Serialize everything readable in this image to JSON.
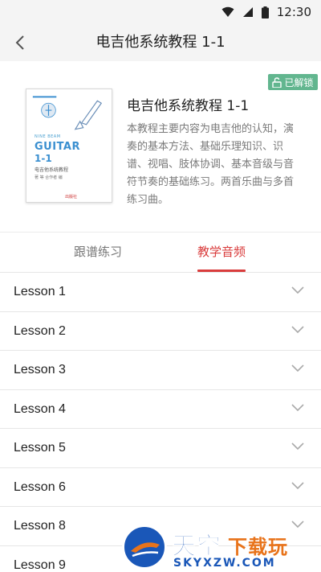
{
  "status_bar": {
    "time": "12:30",
    "icons": [
      "wifi-icon",
      "signal-icon",
      "battery-icon"
    ]
  },
  "nav": {
    "title": "电吉他系统教程 1-1",
    "back_icon": "chevron-left-icon"
  },
  "course": {
    "unlock_badge": "已解锁",
    "unlock_icon": "unlock-icon",
    "title": "电吉他系统教程 1-1",
    "description": "本教程主要内容为电吉他的认知，演奏的基本方法、基础乐理知识、识谱、视唱、肢体协调、基本音级与音符节奏的基础练习。两首乐曲与多首练习曲。",
    "cover": {
      "series": "NINE BEAM",
      "instrument": "GUITAR",
      "level": "1-1",
      "subtitle": "电吉他系统教程",
      "authors": "著  等  合作者  编",
      "publisher": "出版社"
    }
  },
  "tabs": [
    {
      "label": "跟谱练习",
      "active": false
    },
    {
      "label": "教学音频",
      "active": true
    }
  ],
  "lessons": [
    {
      "label": "Lesson 1"
    },
    {
      "label": "Lesson 2"
    },
    {
      "label": "Lesson 3"
    },
    {
      "label": "Lesson 4"
    },
    {
      "label": "Lesson 5"
    },
    {
      "label": "Lesson 6"
    },
    {
      "label": "Lesson 8"
    },
    {
      "label": "Lesson 9"
    }
  ],
  "watermark": {
    "brand_a": "天空",
    "brand_b": "下载玩",
    "url": "SKYXZW.COM"
  },
  "colors": {
    "accent": "#d93c3c",
    "unlock_badge": "#62b68f",
    "nav_bg": "#f4f4f4",
    "watermark_blue": "#1a57b8",
    "watermark_orange": "#e8731a"
  }
}
